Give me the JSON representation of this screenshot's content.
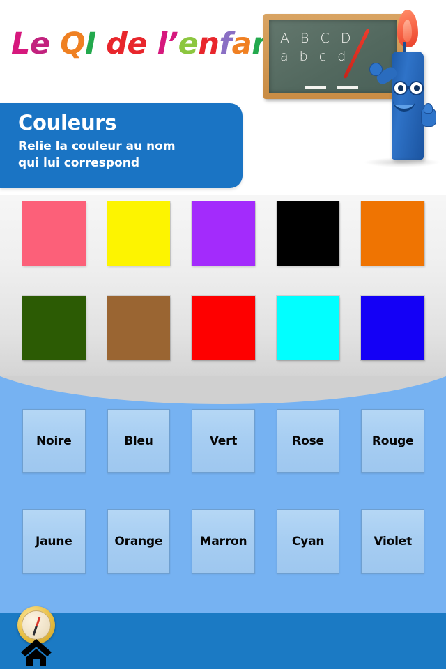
{
  "app": {
    "title": "Le QI de l'enfant",
    "title_letters": [
      {
        "ch": "L",
        "color": "#d6187d"
      },
      {
        "ch": "e",
        "color": "#c2227e"
      },
      {
        "ch": " ",
        "color": "#000000"
      },
      {
        "ch": "Q",
        "color": "#ef8022"
      },
      {
        "ch": "I",
        "color": "#23a94d"
      },
      {
        "ch": " ",
        "color": "#000000"
      },
      {
        "ch": "d",
        "color": "#e8262c"
      },
      {
        "ch": "e",
        "color": "#e8262c"
      },
      {
        "ch": " ",
        "color": "#000000"
      },
      {
        "ch": "l",
        "color": "#d6187d"
      },
      {
        "ch": "’",
        "color": "#d6187d"
      },
      {
        "ch": "e",
        "color": "#8cc63f"
      },
      {
        "ch": "n",
        "color": "#e8262c"
      },
      {
        "ch": "f",
        "color": "#8a6fc4"
      },
      {
        "ch": "a",
        "color": "#f08022"
      },
      {
        "ch": "n",
        "color": "#23a94d"
      },
      {
        "ch": "t",
        "color": "#d6187d"
      }
    ]
  },
  "scene": {
    "blackboard_line_upper": "A B C D",
    "blackboard_line_lower": "a b c d",
    "chalkboard_color": "#55695f",
    "frame_color": "#c98c44",
    "character_color": "#2a6cbe",
    "pointer_color": "#e0332a",
    "flame_color": "#f9694a"
  },
  "banner": {
    "title": "Couleurs",
    "subtitle": "Relie la couleur au nom\nqui lui correspond",
    "background": "#1a74c4"
  },
  "swatches": {
    "row_1": [
      {
        "name": "pink-swatch",
        "color": "#fc6079"
      },
      {
        "name": "yellow-swatch",
        "color": "#fdf400"
      },
      {
        "name": "purple-swatch",
        "color": "#a32bfc"
      },
      {
        "name": "black-swatch",
        "color": "#000000"
      },
      {
        "name": "orange-swatch",
        "color": "#ef7402"
      }
    ],
    "row_2": [
      {
        "name": "green-swatch",
        "color": "#2c5b04"
      },
      {
        "name": "brown-swatch",
        "color": "#9a6532"
      },
      {
        "name": "red-swatch",
        "color": "#fe0000"
      },
      {
        "name": "cyan-swatch",
        "color": "#01ffff"
      },
      {
        "name": "blue-swatch",
        "color": "#1400f6"
      }
    ]
  },
  "words": {
    "panel_color": "#76b2f2",
    "row_1": [
      "Noire",
      "Bleu",
      "Vert",
      "Rose",
      "Rouge"
    ],
    "row_2": [
      "Jaune",
      "Orange",
      "Marron",
      "Cyan",
      "Violet"
    ]
  },
  "bottom_bar": {
    "background": "#1b7ac4",
    "icons": [
      "compass-icon",
      "home-icon"
    ]
  }
}
